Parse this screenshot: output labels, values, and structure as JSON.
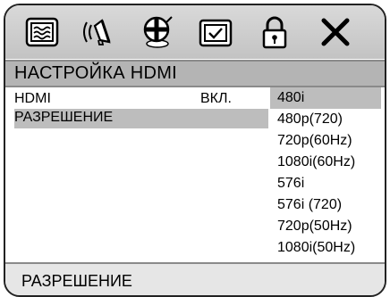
{
  "toolbar": {
    "icons": [
      "general-setup-icon",
      "audio-setup-icon",
      "video-setup-icon",
      "preference-icon",
      "password-lock-icon",
      "exit-icon"
    ]
  },
  "header": {
    "title": "НАСТРОЙКА HDMI"
  },
  "settings": [
    {
      "label": "HDMI",
      "value": "ВКЛ."
    },
    {
      "label": "РАЗРЕШЕНИЕ",
      "value": ""
    }
  ],
  "resolution_options": [
    "480i",
    "480p(720)",
    "720p(60Hz)",
    "1080i(60Hz)",
    "576i",
    "576i (720)",
    "720p(50Hz)",
    "1080i(50Hz)"
  ],
  "selected_option": "480i",
  "footer": {
    "hint": "РАЗРЕШЕНИЕ"
  },
  "colors": {
    "toolbar_bg": "#c8c8c8",
    "title_bg": "#b4b4b4",
    "highlight": "#bdbdbd",
    "footer_bg": "#e6e6e6"
  }
}
